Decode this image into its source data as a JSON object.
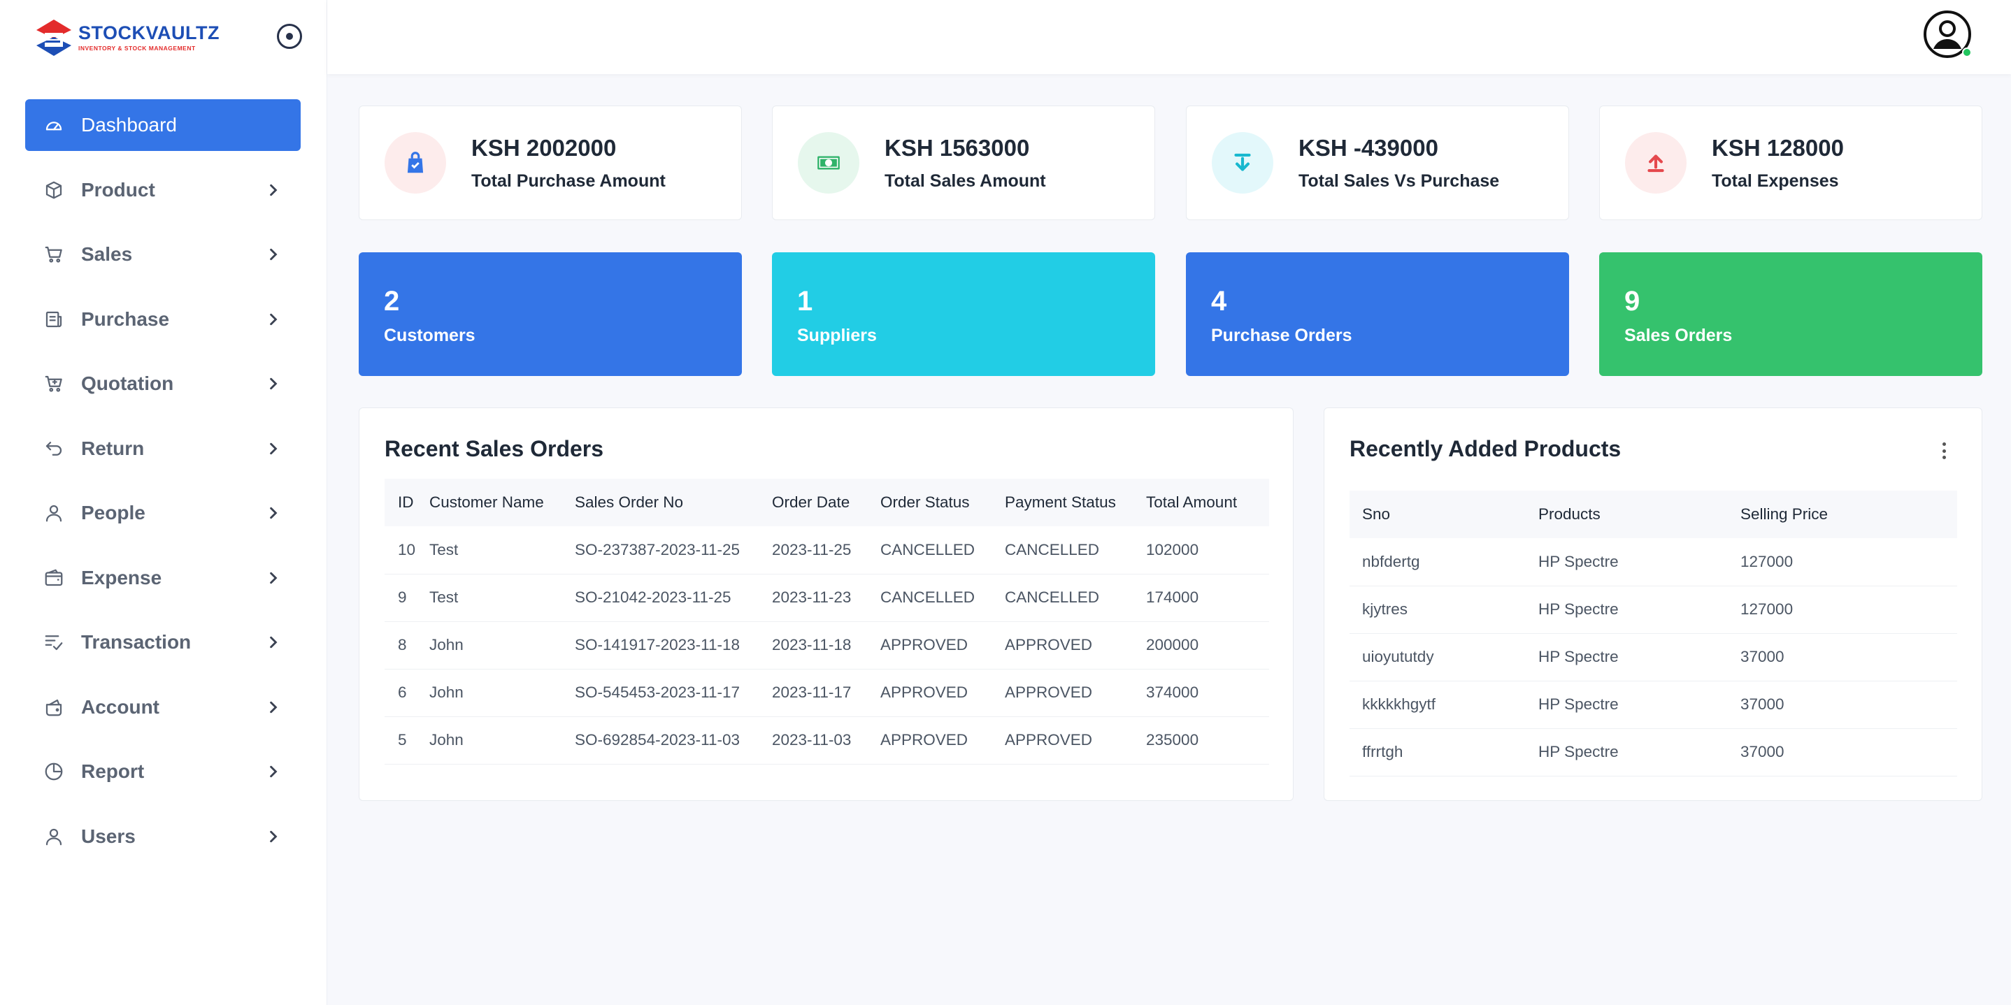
{
  "brand": {
    "name": "STOCKVAULTZ",
    "tagline": "INVENTORY & STOCK MANAGEMENT"
  },
  "sidebar": {
    "items": [
      {
        "label": "Dashboard",
        "icon": "dashboard-icon",
        "active": true
      },
      {
        "label": "Product",
        "icon": "box-icon"
      },
      {
        "label": "Sales",
        "icon": "cart-icon"
      },
      {
        "label": "Purchase",
        "icon": "receipt-icon"
      },
      {
        "label": "Quotation",
        "icon": "cart-plus-icon"
      },
      {
        "label": "Return",
        "icon": "return-icon"
      },
      {
        "label": "People",
        "icon": "person-icon"
      },
      {
        "label": "Expense",
        "icon": "wallet-icon"
      },
      {
        "label": "Transaction",
        "icon": "checklist-icon"
      },
      {
        "label": "Account",
        "icon": "purse-icon"
      },
      {
        "label": "Report",
        "icon": "pie-chart-icon"
      },
      {
        "label": "Users",
        "icon": "user-icon"
      }
    ]
  },
  "stats": [
    {
      "amount": "KSH 2002000",
      "label": "Total Purchase Amount",
      "icon": "shopping-bag-icon",
      "bg": "#fdecec",
      "color": "#3475e7"
    },
    {
      "amount": "KSH 1563000",
      "label": "Total Sales Amount",
      "icon": "cash-icon",
      "bg": "#e6f7ed",
      "color": "#2fb36a"
    },
    {
      "amount": "KSH -439000",
      "label": "Total Sales Vs Purchase",
      "icon": "download-icon",
      "bg": "#e3f8fb",
      "color": "#17b8cf"
    },
    {
      "amount": "KSH 128000",
      "label": "Total Expenses",
      "icon": "upload-icon",
      "bg": "#fdecec",
      "color": "#e5484d"
    }
  ],
  "counts": [
    {
      "number": "2",
      "label": "Customers",
      "color": "#3475e7"
    },
    {
      "number": "1",
      "label": "Suppliers",
      "color": "#22cde5"
    },
    {
      "number": "4",
      "label": "Purchase Orders",
      "color": "#3475e7"
    },
    {
      "number": "9",
      "label": "Sales Orders",
      "color": "#35c26d"
    }
  ],
  "recent_sales": {
    "title": "Recent Sales Orders",
    "headers": [
      "ID",
      "Customer Name",
      "Sales Order No",
      "Order Date",
      "Order Status",
      "Payment Status",
      "Total Amount"
    ],
    "rows": [
      [
        "10",
        "Test",
        "SO-237387-2023-11-25",
        "2023-11-25",
        "CANCELLED",
        "CANCELLED",
        "102000"
      ],
      [
        "9",
        "Test",
        "SO-21042-2023-11-25",
        "2023-11-23",
        "CANCELLED",
        "CANCELLED",
        "174000"
      ],
      [
        "8",
        "John",
        "SO-141917-2023-11-18",
        "2023-11-18",
        "APPROVED",
        "APPROVED",
        "200000"
      ],
      [
        "6",
        "John",
        "SO-545453-2023-11-17",
        "2023-11-17",
        "APPROVED",
        "APPROVED",
        "374000"
      ],
      [
        "5",
        "John",
        "SO-692854-2023-11-03",
        "2023-11-03",
        "APPROVED",
        "APPROVED",
        "235000"
      ]
    ]
  },
  "recent_products": {
    "title": "Recently Added Products",
    "headers": [
      "Sno",
      "Products",
      "Selling Price"
    ],
    "rows": [
      [
        "nbfdertg",
        "HP Spectre",
        "127000"
      ],
      [
        "kjytres",
        "HP Spectre",
        "127000"
      ],
      [
        "uioyututdy",
        "HP Spectre",
        "37000"
      ],
      [
        "kkkkkhgytf",
        "HP Spectre",
        "37000"
      ],
      [
        "ffrrtgh",
        "HP Spectre",
        "37000"
      ]
    ]
  }
}
